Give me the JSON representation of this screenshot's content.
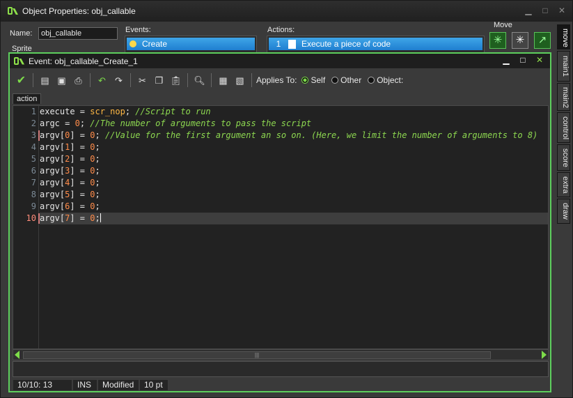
{
  "outer": {
    "title": "Object Properties: obj_callable",
    "name_label": "Name:",
    "name_value": "obj_callable",
    "sprite_label": "Sprite",
    "events_label": "Events:",
    "events": [
      "Create"
    ],
    "actions_label": "Actions:",
    "actions": [
      {
        "num": "1",
        "label": "Execute a piece of code"
      }
    ],
    "move_label": "Move",
    "vtabs": [
      "move",
      "main1",
      "main2",
      "control",
      "score",
      "extra",
      "draw"
    ]
  },
  "inner": {
    "title": "Event: obj_callable_Create_1",
    "applies_to_label": "Applies To:",
    "applies_options": [
      "Self",
      "Other",
      "Object:"
    ],
    "tab": "action",
    "line_numbers": [
      "1",
      "2",
      "3",
      "4",
      "5",
      "6",
      "7",
      "8",
      "9",
      "10"
    ],
    "status": {
      "position": "10/10: 13",
      "mode": "INS",
      "modified": "Modified",
      "font_size": "10 pt"
    }
  },
  "colors": {
    "accent_green": "#5dcf5d",
    "comment": "#8dd850",
    "number": "#ff8c4a",
    "function": "#ffb844",
    "selection": "#3fa5e8"
  }
}
